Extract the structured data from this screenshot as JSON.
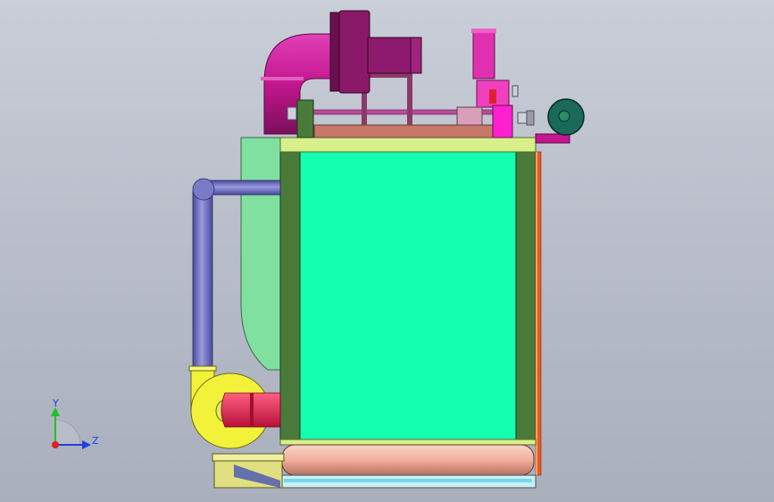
{
  "viewport": {
    "background_top": "#c9ced8",
    "background_bottom": "#a9afbc"
  },
  "colors": {
    "main_panel": "#14ffb0",
    "side_column": "#4a7a3a",
    "side_housing": "#7fe0a0",
    "top_plate": "#d8f08a",
    "flue_pipe": "#c4168f",
    "flue_dark": "#6a1050",
    "blue_pipe": "#6a6ab8",
    "yellow_fan": "#f2f23a",
    "red_fan_outlet": "#e8285a",
    "bottom_drum": "#f0b4a0",
    "right_trim": "#e85a20",
    "teal_wheel": "#1a6a5a",
    "pink_valve": "#f040c0"
  },
  "triad": {
    "y_label": "Y",
    "z_label": "Z",
    "y_color": "#20c020",
    "z_color": "#2040e0",
    "origin_color": "#e02020"
  }
}
